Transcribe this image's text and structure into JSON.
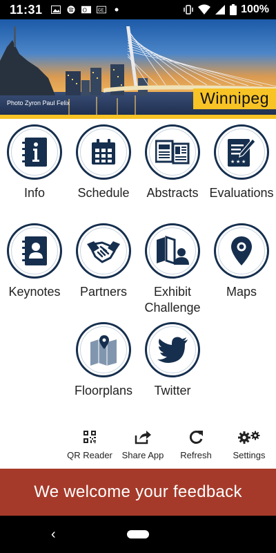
{
  "status_bar": {
    "time": "11:31",
    "battery": "100%",
    "left_icons": [
      "image-icon",
      "spotify-icon",
      "outlook-icon",
      "news-icon",
      "dot-icon"
    ],
    "right_icons": [
      "vibrate-icon",
      "wifi-icon",
      "signal-icon",
      "battery-icon"
    ]
  },
  "hero": {
    "photo_credit": "Photo Zyron Paul Felix",
    "city": "Winnipeg"
  },
  "tiles": [
    {
      "label": "Info",
      "icon": "info-icon"
    },
    {
      "label": "Schedule",
      "icon": "calendar-icon"
    },
    {
      "label": "Abstracts",
      "icon": "abstracts-icon"
    },
    {
      "label": "Evaluations",
      "icon": "evaluations-icon"
    },
    {
      "label": "Keynotes",
      "icon": "contact-book-icon"
    },
    {
      "label": "Partners",
      "icon": "handshake-icon"
    },
    {
      "label": "Exhibit\nChallenge",
      "label_line1": "Exhibit",
      "label_line2": "Challenge",
      "icon": "exhibit-icon"
    },
    {
      "label": "Maps",
      "icon": "map-pin-icon"
    },
    {
      "label": "Floorplans",
      "icon": "floorplan-icon"
    },
    {
      "label": "Twitter",
      "icon": "twitter-icon"
    }
  ],
  "toolbar": [
    {
      "label": "QR Reader",
      "icon": "qr-code-icon"
    },
    {
      "label": "Share App",
      "icon": "share-icon"
    },
    {
      "label": "Refresh",
      "icon": "refresh-icon"
    },
    {
      "label": "Settings",
      "icon": "gears-icon"
    }
  ],
  "feedback": {
    "label": "We welcome your feedback"
  },
  "colors": {
    "icon_navy": "#162f4e",
    "badge_yellow": "#f7c325",
    "feedback_red": "#a63a2a"
  }
}
